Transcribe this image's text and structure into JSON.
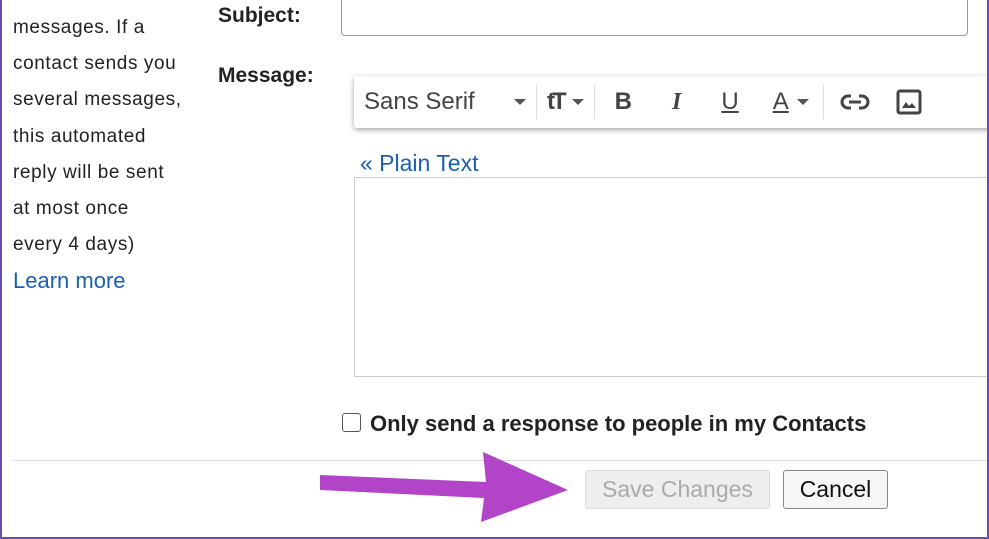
{
  "sidebar": {
    "lines": [
      "messages. If a",
      "contact sends you",
      "several messages,",
      "this automated",
      "reply will be sent",
      "at most once",
      "every 4 days)"
    ],
    "learn_more": "Learn more"
  },
  "form": {
    "subject_label": "Subject:",
    "subject_value": "",
    "message_label": "Message:",
    "plain_text_link": "« Plain Text",
    "message_value": ""
  },
  "toolbar": {
    "font": "Sans Serif",
    "size_icon": "tT",
    "bold": "B",
    "italic": "I",
    "underline": "U",
    "color": "A"
  },
  "contacts_only": {
    "label": "Only send a response to people in my Contacts",
    "checked": false
  },
  "buttons": {
    "save": "Save Changes",
    "cancel": "Cancel"
  },
  "colors": {
    "arrow": "#b244c8",
    "link": "#1a5fb4",
    "frame": "#6a4fae"
  }
}
